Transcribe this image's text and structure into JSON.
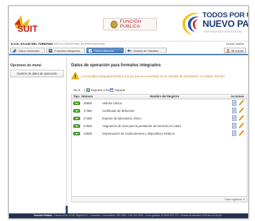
{
  "header": {
    "suit_logo_text": "SUIT",
    "funcion_publica_text": "FUNCIÓN PÚBLICA",
    "gov_line1": "TODOS POR UN",
    "gov_line2": "NUEVO PAÍS",
    "gov_line3": "PAZ   EQUIDAD   EDUCACIÓN"
  },
  "institution": {
    "name": "E.S.E. SALUD DEL TUNDAMA",
    "location": " BOYACÁ/DUITAMA (NAPROCESO15)",
    "logout": "Cerrar sesión"
  },
  "tabs": [
    {
      "label": "Datos Generales"
    },
    {
      "label": "Formatos integrados"
    },
    {
      "label": "Racionalización"
    },
    {
      "label": "Gestión de Trámites"
    }
  ],
  "tab_right": {
    "label": "Mi cuenta"
  },
  "sidebar": {
    "title": "Opciones de menú",
    "button": "Gestión de datos de operación"
  },
  "main": {
    "title": "Datos de operación para formatos integrados",
    "warning": "Los formatos integrados listados son los que se encuentran en la \"Gestión de inventarios\" en estado \"Inscrito\"",
    "toolbar": {
      "view": "Ver",
      "export": "Exportar a Excel",
      "separate": "Separar"
    },
    "columns": {
      "tipo": "Tipo",
      "numero": "Número",
      "nombre": "Nombre del Registro",
      "acciones": "Acciones"
    },
    "rows": [
      {
        "numero": "26955",
        "nombre": "Historia clínica"
      },
      {
        "numero": "27380",
        "nombre": "Certificado de defunción"
      },
      {
        "numero": "27388",
        "nombre": "Examen de laboratorio clínico"
      },
      {
        "numero": "27555",
        "nombre": "Asignación de citas para la prestación de servicios en salud"
      },
      {
        "numero": "42805",
        "nombre": "Dispensación de medicamentos y dispositivos médicos"
      }
    ],
    "total": "Total registros: 5"
  },
  "footer": {
    "text_bold": "Función Pública",
    "text": " - Carrera 6 No. 12-62, Bogotá D.C., Colombia - Conmutador: 334 4080 - Fax: 341 0515 - Línea gratuita: 01 8000 917 770 - Horario de atención: 8:00 am a 5:00 pm"
  },
  "colors": {
    "accent_blue": "#4d7fb6",
    "footer_bg": "#23334f",
    "warning": "#c47a1a",
    "go_green": "#3f9a1f"
  }
}
